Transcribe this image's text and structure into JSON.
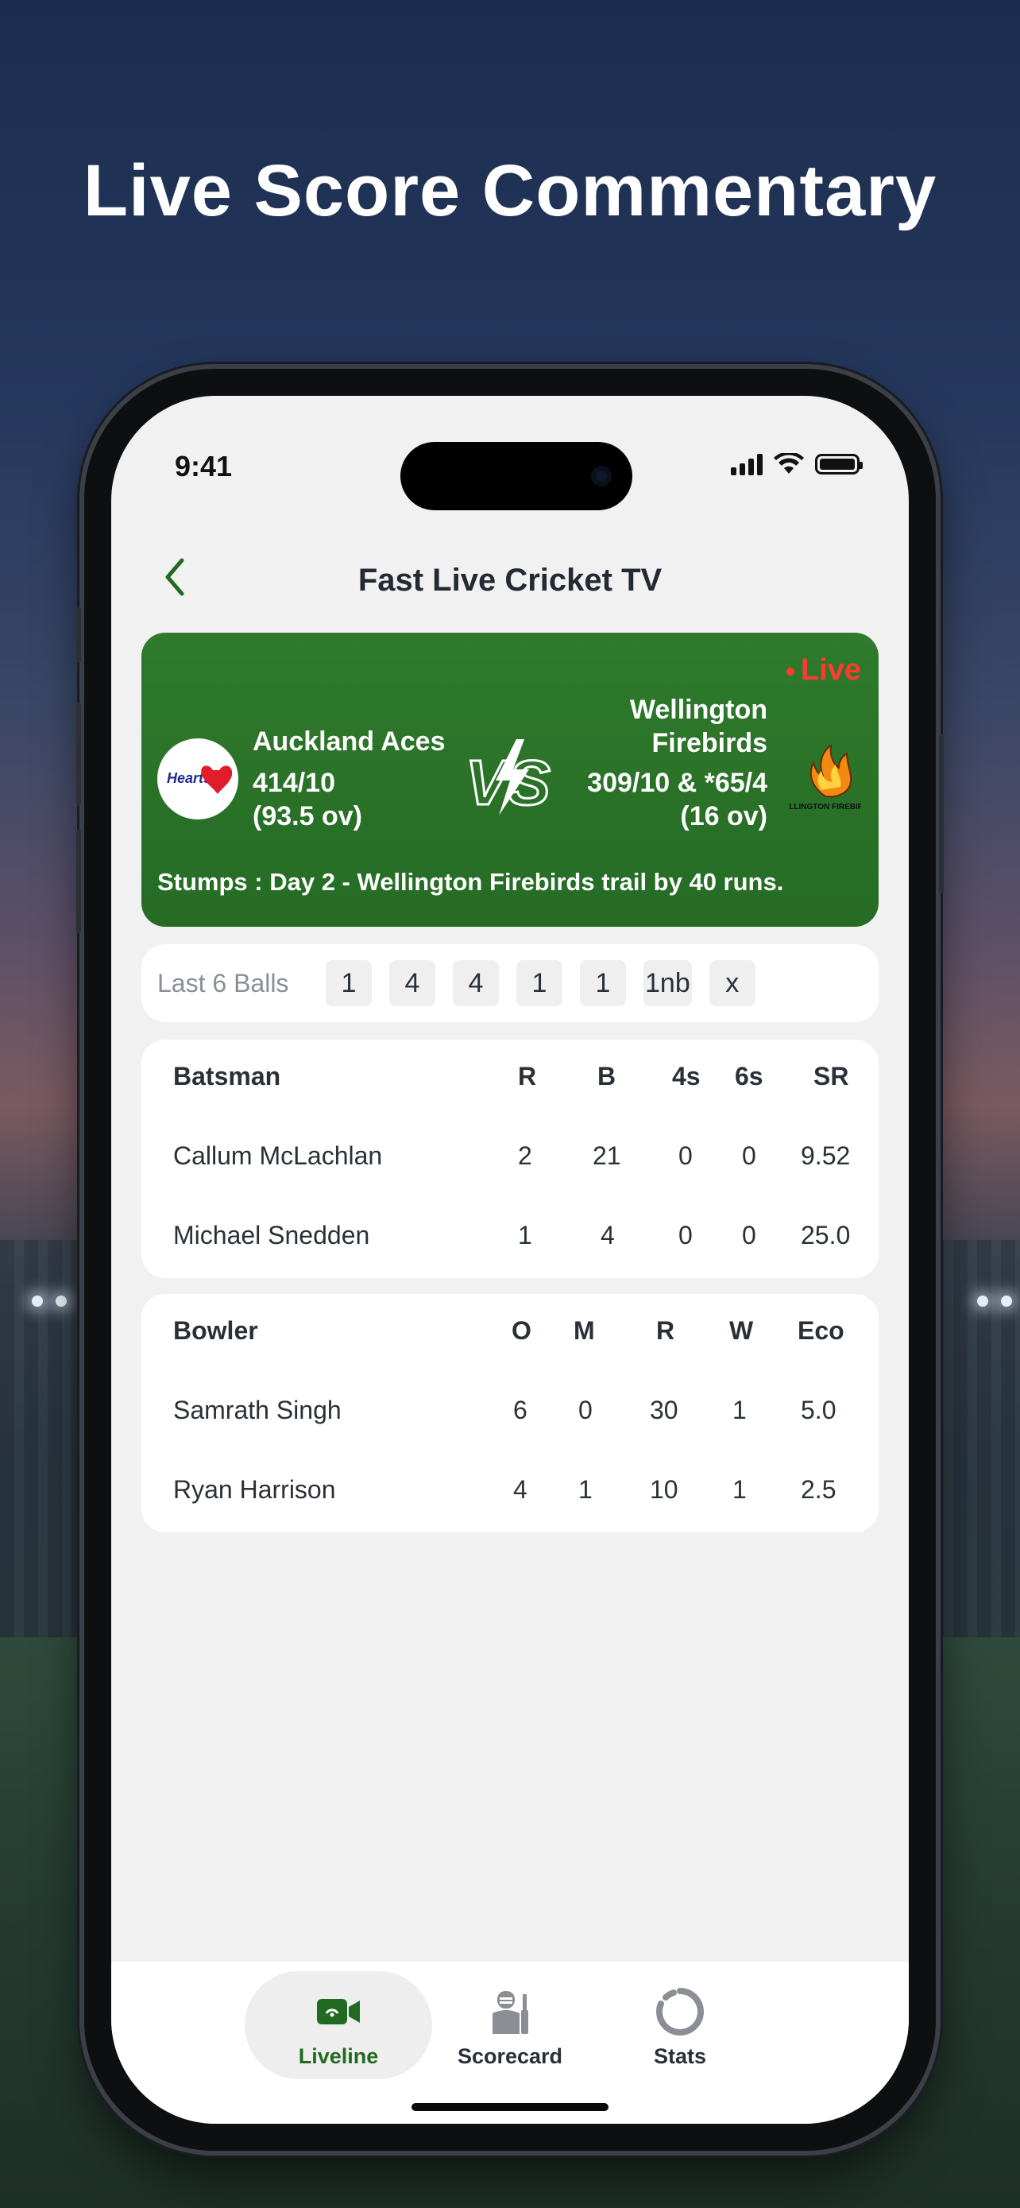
{
  "headline": "Live Score Commentary",
  "status_bar": {
    "time": "9:41",
    "icons": [
      "cellular-signal-icon",
      "wifi-icon",
      "battery-icon"
    ]
  },
  "nav": {
    "back_icon": "chevron-left-icon",
    "title": "Fast Live Cricket TV"
  },
  "match": {
    "live_label": "Live",
    "team_a": {
      "name": "Auckland Aces",
      "score": "414/10",
      "overs": "(93.5 ov)",
      "logo_text": "Hearts",
      "logo": "heart-logo"
    },
    "vs_icon": "vs-lightning-icon",
    "team_b": {
      "name_line1": "Wellington",
      "name_line2": "Firebirds",
      "score": "309/10 & *65/4",
      "overs": "(16 ov)",
      "logo": "firebirds-logo",
      "logo_text": "WELLINGTON FIREBIRDS"
    },
    "status": "Stumps : Day 2 - Wellington Firebirds trail by 40 runs."
  },
  "last_balls": {
    "label": "Last 6 Balls",
    "balls": [
      "1",
      "4",
      "4",
      "1",
      "1",
      "1nb",
      "x"
    ]
  },
  "batting": {
    "headers": {
      "name": "Batsman",
      "r": "R",
      "b": "B",
      "fours": "4s",
      "sixes": "6s",
      "sr": "SR"
    },
    "rows": [
      {
        "name": "Callum McLachlan",
        "r": "2",
        "b": "21",
        "fours": "0",
        "sixes": "0",
        "sr": "9.52"
      },
      {
        "name": "Michael Snedden",
        "r": "1",
        "b": "4",
        "fours": "0",
        "sixes": "0",
        "sr": "25.0"
      }
    ]
  },
  "bowling": {
    "headers": {
      "name": "Bowler",
      "o": "O",
      "m": "M",
      "r": "R",
      "w": "W",
      "eco": "Eco"
    },
    "rows": [
      {
        "name": "Samrath Singh",
        "o": "6",
        "m": "0",
        "r": "30",
        "w": "1",
        "eco": "5.0"
      },
      {
        "name": "Ryan Harrison",
        "o": "4",
        "m": "1",
        "r": "10",
        "w": "1",
        "eco": "2.5"
      }
    ]
  },
  "tabs": [
    {
      "label": "Liveline",
      "icon": "video-camera-icon",
      "active": true
    },
    {
      "label": "Scorecard",
      "icon": "cricket-scorecard-icon",
      "active": false
    },
    {
      "label": "Stats",
      "icon": "stats-ring-icon",
      "active": false
    }
  ],
  "colors": {
    "brand_green": "#256b24",
    "live_red": "#ff3b30",
    "active_tab_text": "#226a22"
  }
}
